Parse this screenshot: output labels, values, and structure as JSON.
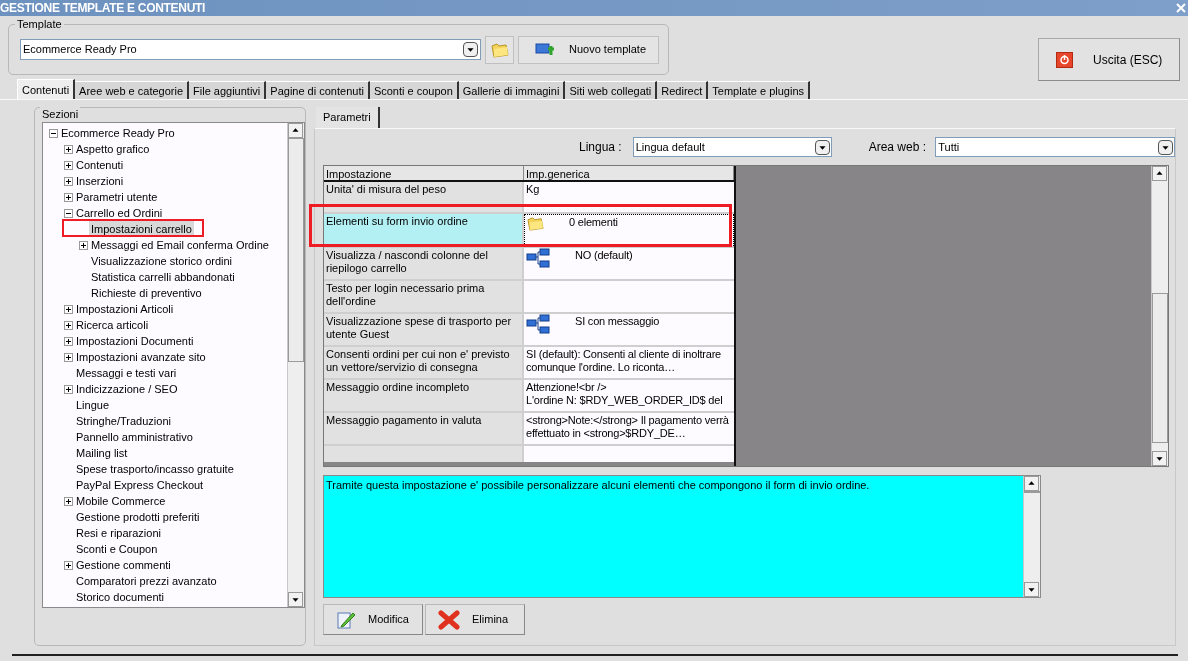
{
  "window": {
    "title": "GESTIONE TEMPLATE E CONTENUTI"
  },
  "template": {
    "label": "Template",
    "value": "Ecommerce Ready Pro",
    "new_button": "Nuovo template"
  },
  "exit_button": "Uscita (ESC)",
  "tabs": [
    {
      "label": "Contenuti",
      "selected": true
    },
    {
      "label": "Aree web e categorie",
      "selected": false
    },
    {
      "label": "File aggiuntivi",
      "selected": false
    },
    {
      "label": "Pagine di contenuti",
      "selected": false
    },
    {
      "label": "Sconti e coupon",
      "selected": false
    },
    {
      "label": "Gallerie di immagini",
      "selected": false
    },
    {
      "label": "Siti web collegati",
      "selected": false
    },
    {
      "label": "Redirect",
      "selected": false
    },
    {
      "label": "Template e plugins",
      "selected": false
    }
  ],
  "sections": {
    "label": "Sezioni",
    "tree": [
      {
        "label": "Ecommerce Ready Pro",
        "expanded": true,
        "selected": false,
        "children": [
          {
            "label": "Aspetto grafico",
            "expanded": false,
            "selected": false
          },
          {
            "label": "Contenuti",
            "expanded": false,
            "selected": false
          },
          {
            "label": "Inserzioni",
            "expanded": false,
            "selected": false
          },
          {
            "label": "Parametri utente",
            "expanded": false,
            "selected": false
          },
          {
            "label": "Carrello ed Ordini",
            "expanded": true,
            "selected": false,
            "children": [
              {
                "label": "Impostazioni carrello",
                "selected": true
              },
              {
                "label": "Messaggi ed Email conferma Ordine",
                "expanded": false,
                "selected": false
              },
              {
                "label": "Visualizzazione storico ordini",
                "selected": false
              },
              {
                "label": "Statistica carrelli abbandonati",
                "selected": false
              },
              {
                "label": "Richieste di preventivo",
                "selected": false
              }
            ]
          },
          {
            "label": "Impostazioni Articoli",
            "expanded": false,
            "selected": false
          },
          {
            "label": "Ricerca articoli",
            "expanded": false,
            "selected": false
          },
          {
            "label": "Impostazioni Documenti",
            "expanded": false,
            "selected": false
          },
          {
            "label": "Impostazioni avanzate sito",
            "expanded": false,
            "selected": false
          },
          {
            "label": "Messaggi e testi vari",
            "selected": false
          },
          {
            "label": "Indicizzazione / SEO",
            "expanded": false,
            "selected": false
          },
          {
            "label": "Lingue",
            "selected": false
          },
          {
            "label": "Stringhe/Traduzioni",
            "selected": false
          },
          {
            "label": "Pannello amministrativo",
            "selected": false
          },
          {
            "label": "Mailing list",
            "selected": false
          },
          {
            "label": "Spese trasporto/incasso gratuite",
            "selected": false
          },
          {
            "label": "PayPal Express Checkout",
            "selected": false
          },
          {
            "label": "Mobile Commerce",
            "expanded": false,
            "selected": false
          },
          {
            "label": "Gestione prodotti preferiti",
            "selected": false
          },
          {
            "label": "Resi e riparazioni",
            "selected": false
          },
          {
            "label": "Sconti e Coupon",
            "selected": false
          },
          {
            "label": "Gestione commenti",
            "expanded": false,
            "selected": false
          },
          {
            "label": "Comparatori prezzi avanzato",
            "selected": false
          },
          {
            "label": "Storico documenti",
            "selected": false
          }
        ]
      }
    ]
  },
  "parameters_tab": {
    "label": "Parametri",
    "selected": true
  },
  "filters": {
    "language_label": "Lingua :",
    "language": "Lingua default",
    "area_label": "Area web :",
    "area": "Tutti"
  },
  "grid": {
    "columns": [
      "Impostazione",
      "Imp.generica"
    ],
    "rows": [
      {
        "setting": "Unita' di misura del peso",
        "value": "Kg",
        "kind": "text",
        "selected": false
      },
      {
        "setting": "Elementi su form invio ordine",
        "value": "0 elementi",
        "kind": "folder",
        "selected": true
      },
      {
        "setting": "Visualizza / nascondi colonne del riepilogo carrello",
        "value": "NO (default)",
        "kind": "tree",
        "selected": false
      },
      {
        "setting": "Testo per login necessario prima dell'ordine",
        "value": "",
        "kind": "text",
        "selected": false
      },
      {
        "setting": "Visualizzazione spese di trasporto per utente Guest",
        "value": "SI con messaggio",
        "kind": "tree",
        "selected": false
      },
      {
        "setting": "Consenti ordini per cui non e' previsto un vettore/servizio di consegna",
        "value": "SI (default): Consenti al cliente di inoltrare comunque l'ordine. Lo riconta…",
        "kind": "text",
        "selected": false
      },
      {
        "setting": "Messaggio ordine incompleto",
        "value": "Attenzione!<br />\nL'ordine N: $RDY_WEB_ORDER_ID$ del",
        "kind": "text",
        "selected": false
      },
      {
        "setting": "Messaggio pagamento in valuta",
        "value": "<strong>Note:</strong> Il pagamento verrà effettuato in <strong>$RDY_DE…",
        "kind": "text",
        "selected": false
      }
    ]
  },
  "description": "Tramite questa impostazione e' possibile personalizzare alcuni elementi che compongono il form di invio ordine.",
  "buttons": [
    {
      "label": "Modifica",
      "kind": "edit"
    },
    {
      "label": "Elimina",
      "kind": "delete"
    }
  ]
}
